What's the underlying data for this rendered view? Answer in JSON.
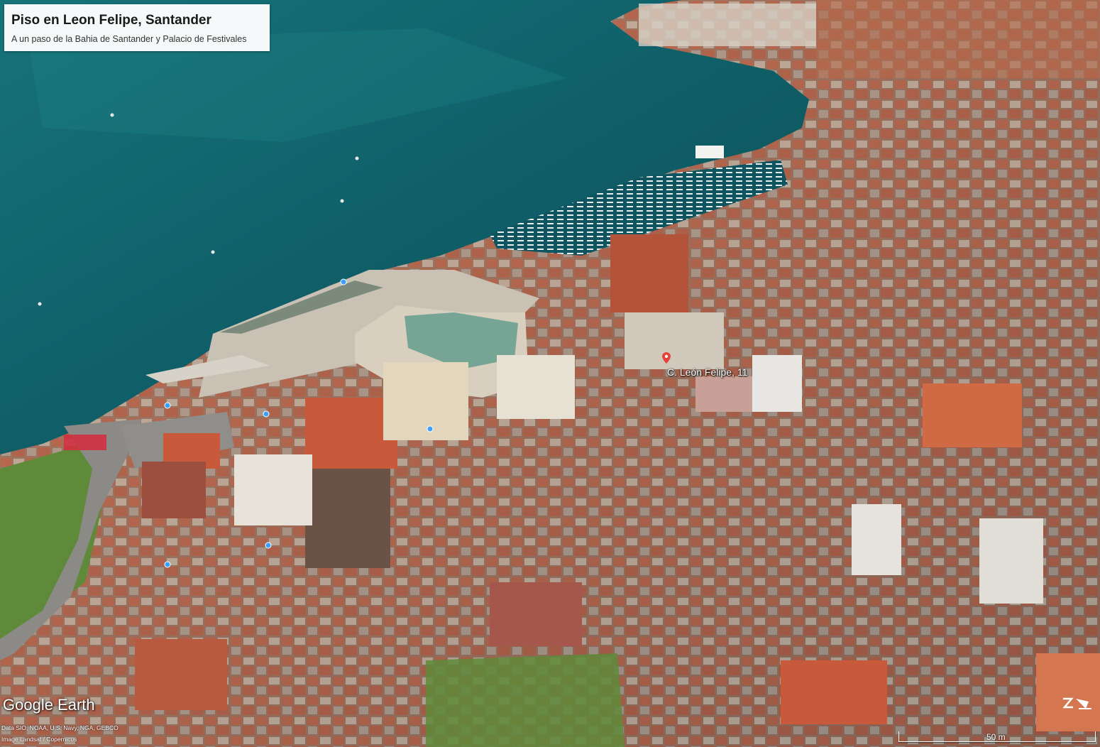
{
  "card": {
    "title": "Piso en Leon Felipe, Santander",
    "subtitle": "A un paso de la Bahia de Santander y Palacio de Festivales"
  },
  "placemark": {
    "label": "C. León Felipe, 11",
    "icon": "map-pin-icon",
    "color": "#e8413a"
  },
  "branding": {
    "logo": "Google Earth"
  },
  "attribution": [
    "Data SIO, NOAA, U.S. Navy, NGA, GEBCO",
    "Image Landsat / Copernicus"
  ],
  "scale_bar": {
    "label": "50 m"
  },
  "compass": {
    "icon": "north-arrow-icon"
  },
  "colors": {
    "sea": "#0f5a64",
    "roof": "#c8593a",
    "facade": "#d9cfbf",
    "lawn": "#5f8a3a"
  }
}
